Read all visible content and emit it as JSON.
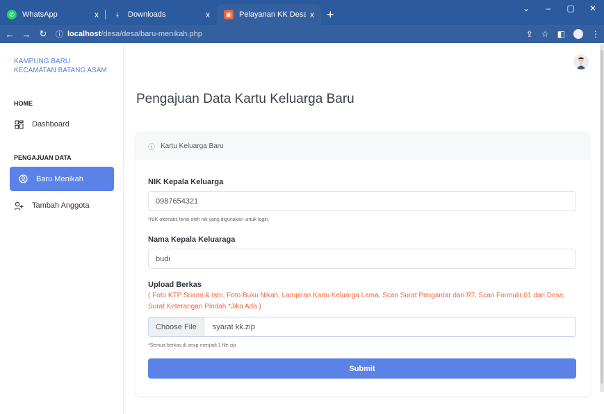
{
  "browser": {
    "tabs": [
      {
        "title": "WhatsApp",
        "close": "x"
      },
      {
        "title": "Downloads",
        "close": "x"
      },
      {
        "title": "Pelayanan KK Desa",
        "close": "x"
      }
    ],
    "new_tab": "+",
    "url_host": "localhost",
    "url_path": "/desa/desa/baru-menikah.php"
  },
  "sidebar": {
    "brand_line1": "KAMPUNG BARU",
    "brand_line2": "KECAMATAN BATANG ASAM",
    "section_home": "HOME",
    "dashboard": "Dashboard",
    "section_pengajuan": "PENGAJUAN DATA",
    "baru_menikah": "Baru Menikah",
    "tambah_anggota": "Tambah Anggota"
  },
  "main": {
    "page_title": "Pengajuan Data Kartu Keluarga Baru",
    "card_header": "Kartu Keluarga Baru",
    "nik_label": "NIK Kepala Keluarga",
    "nik_value": "0987654321",
    "nik_hint": "*NIK otomatis terisi oleh nik yang digunakan untuk login.",
    "nama_label": "Nama Kepala Keluaraga",
    "nama_value": "budi",
    "upload_label": "Upload Berkas",
    "upload_note": "( Foto KTP Suami & Istri, Foto Buku Nikah, Lampiran Kartu Keluarga Lama, Scan Surat Pengantar dari RT, Scan Formulir 01 dari Desa, Surat Keterangan Pindah *Jika Ada )",
    "choose_file": "Choose File",
    "file_name": "syarat kk.zip",
    "file_hint": "*Semua berkas di arsip menjadi 1 file zip",
    "submit": "Submit"
  },
  "colors": {
    "accent": "#5b82e6",
    "note": "#f0643c",
    "tabbar": "#2b5a9e"
  }
}
